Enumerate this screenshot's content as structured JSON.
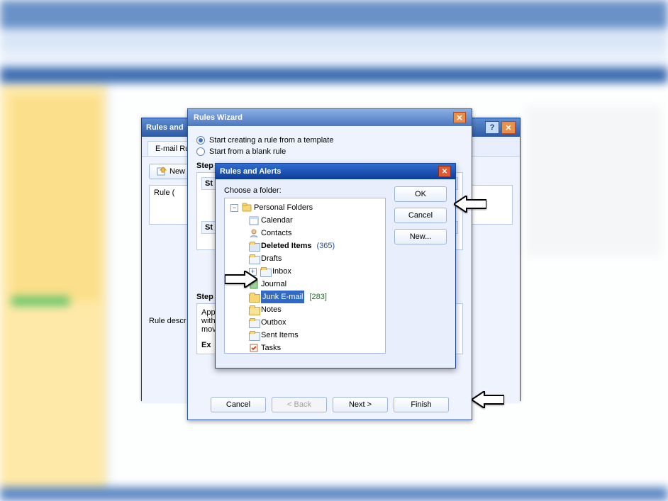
{
  "rules_alerts_back": {
    "title": "Rules and",
    "tab": "E-mail Rule",
    "new_rule_btn": "New R",
    "rule_col": "Rule (",
    "desc_label": "Rule descr"
  },
  "wizard": {
    "title": "Rules Wizard",
    "opt_template": "Start creating a rule from a template",
    "opt_blank": "Start from a blank rule",
    "step1_label": "Step",
    "step1_sub_a": "St",
    "step1_sub_b": "St",
    "step2_label": "Step",
    "step2_line1": "App",
    "step2_line2": "with",
    "step2_line3": "mov",
    "example_label": "Ex",
    "btn_cancel": "Cancel",
    "btn_back": "< Back",
    "btn_next": "Next >",
    "btn_finish": "Finish"
  },
  "picker": {
    "title": "Rules and Alerts",
    "choose": "Choose a folder:",
    "btn_ok": "OK",
    "btn_cancel": "Cancel",
    "btn_new": "New...",
    "root": "Personal Folders",
    "items": {
      "calendar": "Calendar",
      "contacts": "Contacts",
      "deleted": "Deleted Items",
      "deleted_count": "(365)",
      "drafts": "Drafts",
      "inbox": "Inbox",
      "journal": "Journal",
      "junk": "Junk E-mail",
      "junk_count": "[283]",
      "notes": "Notes",
      "outbox": "Outbox",
      "sent": "Sent Items",
      "tasks": "Tasks"
    }
  }
}
